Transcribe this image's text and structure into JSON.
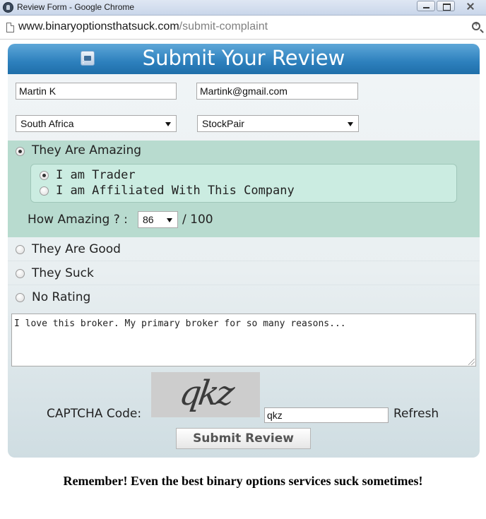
{
  "window": {
    "title": "Review Form - Google Chrome"
  },
  "address_bar": {
    "host": "www.binaryoptionsthatsuck.com",
    "path": "/submit-complaint"
  },
  "form": {
    "title": "Submit Your Review",
    "name_value": "Martin K",
    "email_value": "Martink@gmail.com",
    "country_selected": "South Africa",
    "broker_selected": "StockPair",
    "ratings": [
      {
        "label": "They Are Amazing",
        "checked": true
      },
      {
        "label": "They Are Good",
        "checked": false
      },
      {
        "label": "They Suck",
        "checked": false
      },
      {
        "label": "No Rating",
        "checked": false
      }
    ],
    "affiliation": [
      {
        "label": "I am Trader",
        "checked": true
      },
      {
        "label": "I am Affiliated With This Company",
        "checked": false
      }
    ],
    "how_amazing_label": "How Amazing ? :",
    "how_amazing_value": "86",
    "how_amazing_max": "/ 100",
    "review_text": "I love this broker. My primary broker for so many reasons...",
    "captcha_label": "CAPTCHA Code:",
    "captcha_image_text": "qkz",
    "captcha_value": "qkz",
    "refresh_label": "Refresh",
    "submit_label": "Submit Review"
  },
  "footer_note": "Remember! Even the best binary options services suck sometimes!"
}
